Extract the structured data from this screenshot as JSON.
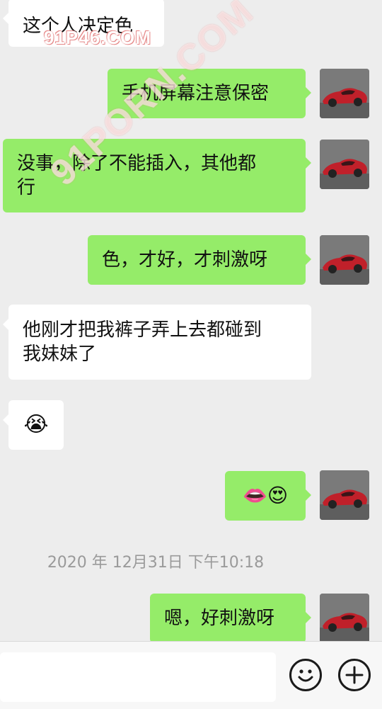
{
  "messages": [
    {
      "text": "这个人决定色"
    },
    {
      "text": "手机屏幕注意保密"
    },
    {
      "text": "没事，除了不能插入，其他都行",
      "lines": [
        "没事，除了不能插入，其他都",
        "行"
      ]
    },
    {
      "text": "色，才好，才刺激呀"
    },
    {
      "text": "他刚才把我裤子弄上去都碰到我妹妹了",
      "lines": [
        "他刚才把我裤子弄上去都碰到",
        "我妹妹了"
      ]
    },
    {
      "emoji": "😭"
    },
    {
      "emoji": "👄😍"
    },
    {
      "text": "嗯，好刺激呀"
    }
  ],
  "timestamp": "2020 年 12月31日 下午10:18",
  "watermarks": [
    "91P46.COM",
    "91PORN.COM"
  ],
  "toolbar": {
    "emoji_icon": "smiley-icon",
    "plus_icon": "plus-icon"
  },
  "colors": {
    "background": "#ededed",
    "outgoing_bubble": "#95ec69",
    "incoming_bubble": "#ffffff"
  }
}
